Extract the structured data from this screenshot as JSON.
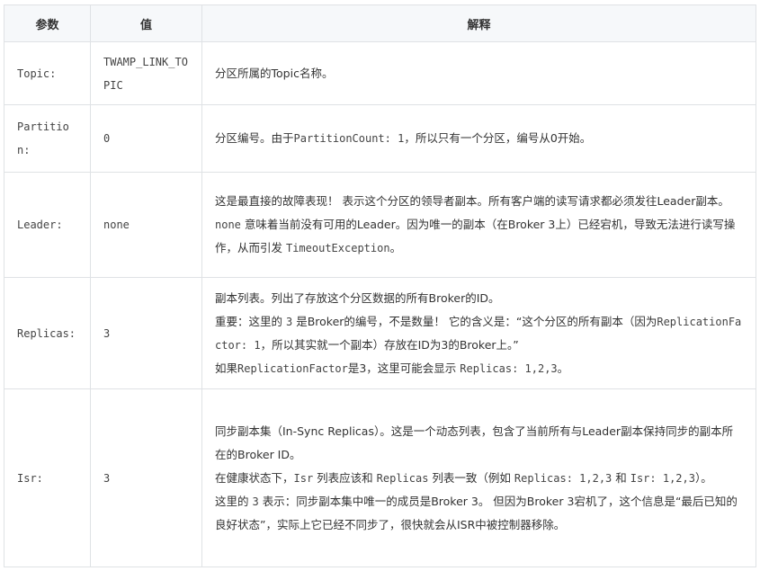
{
  "table": {
    "headers": [
      "参数",
      "值",
      "解释"
    ],
    "rows": [
      {
        "param": "Topic:",
        "value": "TWAMP_LINK_TOPIC",
        "paragraphs": [
          [
            {
              "t": "分区所属的Topic名称。"
            }
          ]
        ]
      },
      {
        "param": "Partition:",
        "value": "0",
        "paragraphs": [
          [
            {
              "t": "分区编号。由于"
            },
            {
              "c": "PartitionCount: 1"
            },
            {
              "t": "，所以只有一个分区，编号从0开始。"
            }
          ]
        ]
      },
      {
        "param": "Leader:",
        "value": "none",
        "paragraphs": [
          [
            {
              "t": "这是最直接的故障表现！ 表示这个分区的领导者副本。所有客户端的读写请求都必须发往Leader副本。"
            }
          ],
          [
            {
              "c": "none"
            },
            {
              "t": " 意味着当前没有可用的Leader。因为唯一的副本（在Broker 3上）已经宕机，导致无法进行读写操作，从而引发 "
            },
            {
              "c": "TimeoutException"
            },
            {
              "t": "。"
            }
          ]
        ]
      },
      {
        "param": "Replicas:",
        "value": "3",
        "paragraphs": [
          [
            {
              "t": "副本列表。列出了存放这个分区数据的所有Broker的ID。"
            }
          ],
          [
            {
              "t": "重要：这里的 "
            },
            {
              "c": "3"
            },
            {
              "t": " 是Broker的编号，不是数量！ 它的含义是：“这个分区的所有副本（因为"
            },
            {
              "c": "ReplicationFactor: 1"
            },
            {
              "t": "，所以其实就一个副本）存放在ID为3的Broker上。”"
            }
          ],
          [
            {
              "t": "如果"
            },
            {
              "c": "ReplicationFactor"
            },
            {
              "t": "是3，这里可能会显示 "
            },
            {
              "c": "Replicas: 1,2,3"
            },
            {
              "t": "。"
            }
          ]
        ]
      },
      {
        "param": "Isr:",
        "value": "3",
        "paragraphs": [
          [
            {
              "t": "同步副本集（In-Sync Replicas）。这是一个动态列表，包含了当前所有与Leader副本保持同步的副本所在的Broker ID。"
            }
          ],
          [
            {
              "t": "在健康状态下，"
            },
            {
              "c": "Isr"
            },
            {
              "t": " 列表应该和 "
            },
            {
              "c": "Replicas"
            },
            {
              "t": " 列表一致（例如 "
            },
            {
              "c": "Replicas: 1,2,3"
            },
            {
              "t": " 和 "
            },
            {
              "c": "Isr: 1,2,3"
            },
            {
              "t": "）。"
            }
          ],
          [
            {
              "t": "这里的 "
            },
            {
              "c": "3"
            },
            {
              "t": " 表示：同步副本集中唯一的成员是Broker 3。 但因为Broker 3宕机了，这个信息是“最后已知的良好状态”，实际上它已经不同步了，很快就会从ISR中被控制器移除。"
            }
          ]
        ]
      }
    ]
  }
}
